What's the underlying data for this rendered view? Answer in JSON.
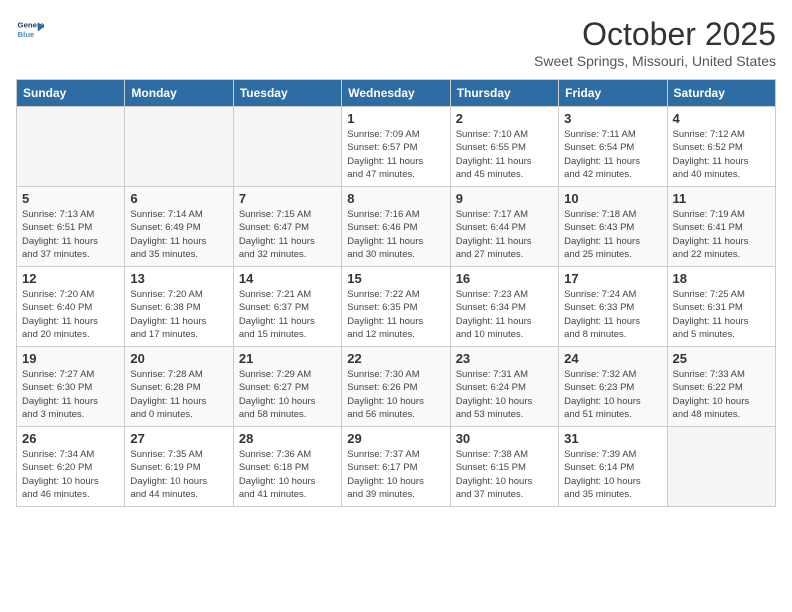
{
  "header": {
    "logo_line1": "General",
    "logo_line2": "Blue",
    "month": "October 2025",
    "location": "Sweet Springs, Missouri, United States"
  },
  "days_of_week": [
    "Sunday",
    "Monday",
    "Tuesday",
    "Wednesday",
    "Thursday",
    "Friday",
    "Saturday"
  ],
  "weeks": [
    [
      {
        "num": "",
        "info": ""
      },
      {
        "num": "",
        "info": ""
      },
      {
        "num": "",
        "info": ""
      },
      {
        "num": "1",
        "info": "Sunrise: 7:09 AM\nSunset: 6:57 PM\nDaylight: 11 hours\nand 47 minutes."
      },
      {
        "num": "2",
        "info": "Sunrise: 7:10 AM\nSunset: 6:55 PM\nDaylight: 11 hours\nand 45 minutes."
      },
      {
        "num": "3",
        "info": "Sunrise: 7:11 AM\nSunset: 6:54 PM\nDaylight: 11 hours\nand 42 minutes."
      },
      {
        "num": "4",
        "info": "Sunrise: 7:12 AM\nSunset: 6:52 PM\nDaylight: 11 hours\nand 40 minutes."
      }
    ],
    [
      {
        "num": "5",
        "info": "Sunrise: 7:13 AM\nSunset: 6:51 PM\nDaylight: 11 hours\nand 37 minutes."
      },
      {
        "num": "6",
        "info": "Sunrise: 7:14 AM\nSunset: 6:49 PM\nDaylight: 11 hours\nand 35 minutes."
      },
      {
        "num": "7",
        "info": "Sunrise: 7:15 AM\nSunset: 6:47 PM\nDaylight: 11 hours\nand 32 minutes."
      },
      {
        "num": "8",
        "info": "Sunrise: 7:16 AM\nSunset: 6:46 PM\nDaylight: 11 hours\nand 30 minutes."
      },
      {
        "num": "9",
        "info": "Sunrise: 7:17 AM\nSunset: 6:44 PM\nDaylight: 11 hours\nand 27 minutes."
      },
      {
        "num": "10",
        "info": "Sunrise: 7:18 AM\nSunset: 6:43 PM\nDaylight: 11 hours\nand 25 minutes."
      },
      {
        "num": "11",
        "info": "Sunrise: 7:19 AM\nSunset: 6:41 PM\nDaylight: 11 hours\nand 22 minutes."
      }
    ],
    [
      {
        "num": "12",
        "info": "Sunrise: 7:20 AM\nSunset: 6:40 PM\nDaylight: 11 hours\nand 20 minutes."
      },
      {
        "num": "13",
        "info": "Sunrise: 7:20 AM\nSunset: 6:38 PM\nDaylight: 11 hours\nand 17 minutes."
      },
      {
        "num": "14",
        "info": "Sunrise: 7:21 AM\nSunset: 6:37 PM\nDaylight: 11 hours\nand 15 minutes."
      },
      {
        "num": "15",
        "info": "Sunrise: 7:22 AM\nSunset: 6:35 PM\nDaylight: 11 hours\nand 12 minutes."
      },
      {
        "num": "16",
        "info": "Sunrise: 7:23 AM\nSunset: 6:34 PM\nDaylight: 11 hours\nand 10 minutes."
      },
      {
        "num": "17",
        "info": "Sunrise: 7:24 AM\nSunset: 6:33 PM\nDaylight: 11 hours\nand 8 minutes."
      },
      {
        "num": "18",
        "info": "Sunrise: 7:25 AM\nSunset: 6:31 PM\nDaylight: 11 hours\nand 5 minutes."
      }
    ],
    [
      {
        "num": "19",
        "info": "Sunrise: 7:27 AM\nSunset: 6:30 PM\nDaylight: 11 hours\nand 3 minutes."
      },
      {
        "num": "20",
        "info": "Sunrise: 7:28 AM\nSunset: 6:28 PM\nDaylight: 11 hours\nand 0 minutes."
      },
      {
        "num": "21",
        "info": "Sunrise: 7:29 AM\nSunset: 6:27 PM\nDaylight: 10 hours\nand 58 minutes."
      },
      {
        "num": "22",
        "info": "Sunrise: 7:30 AM\nSunset: 6:26 PM\nDaylight: 10 hours\nand 56 minutes."
      },
      {
        "num": "23",
        "info": "Sunrise: 7:31 AM\nSunset: 6:24 PM\nDaylight: 10 hours\nand 53 minutes."
      },
      {
        "num": "24",
        "info": "Sunrise: 7:32 AM\nSunset: 6:23 PM\nDaylight: 10 hours\nand 51 minutes."
      },
      {
        "num": "25",
        "info": "Sunrise: 7:33 AM\nSunset: 6:22 PM\nDaylight: 10 hours\nand 48 minutes."
      }
    ],
    [
      {
        "num": "26",
        "info": "Sunrise: 7:34 AM\nSunset: 6:20 PM\nDaylight: 10 hours\nand 46 minutes."
      },
      {
        "num": "27",
        "info": "Sunrise: 7:35 AM\nSunset: 6:19 PM\nDaylight: 10 hours\nand 44 minutes."
      },
      {
        "num": "28",
        "info": "Sunrise: 7:36 AM\nSunset: 6:18 PM\nDaylight: 10 hours\nand 41 minutes."
      },
      {
        "num": "29",
        "info": "Sunrise: 7:37 AM\nSunset: 6:17 PM\nDaylight: 10 hours\nand 39 minutes."
      },
      {
        "num": "30",
        "info": "Sunrise: 7:38 AM\nSunset: 6:15 PM\nDaylight: 10 hours\nand 37 minutes."
      },
      {
        "num": "31",
        "info": "Sunrise: 7:39 AM\nSunset: 6:14 PM\nDaylight: 10 hours\nand 35 minutes."
      },
      {
        "num": "",
        "info": ""
      }
    ]
  ]
}
